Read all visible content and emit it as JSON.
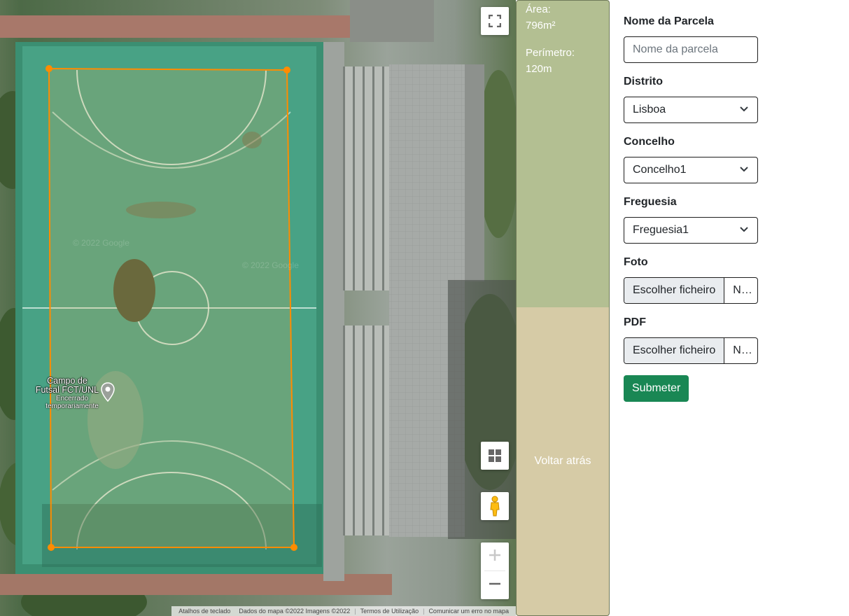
{
  "map": {
    "poi_name": "Campo de Futsal FCT/UNL",
    "poi_name_line1": "Campo de",
    "poi_name_line2": "Futsal FCT/UNL",
    "poi_status": "Encerrado temporariamente",
    "poi_status_line1": "Encerrado",
    "poi_status_line2": "temporariamente",
    "watermark": "© 2022 Google",
    "attribution": {
      "keyboard_shortcuts": "Atalhos de teclado",
      "map_data": "Dados do mapa ©2022 Imagens ©2022",
      "terms": "Termos de Utilização",
      "report_error": "Comunicar um erro no mapa"
    },
    "controls": {
      "fullscreen_icon": "fullscreen-icon",
      "map_type_icon": "grid-icon",
      "pegman_icon": "pegman-icon",
      "zoom_in_icon": "plus-icon",
      "zoom_out_icon": "minus-icon"
    },
    "polygon_color": "#ff8c00"
  },
  "info": {
    "area_label": "Área:",
    "area_value": "796m²",
    "perimeter_label": "Perímetro:",
    "perimeter_value": "120m",
    "back_label": "Voltar atrás"
  },
  "form": {
    "name_label": "Nome da Parcela",
    "name_placeholder": "Nome da parcela",
    "district_label": "Distrito",
    "district_value": "Lisboa",
    "municipality_label": "Concelho",
    "municipality_value": "Concelho1",
    "parish_label": "Freguesia",
    "parish_value": "Freguesia1",
    "photo_label": "Foto",
    "photo_choose": "Escolher ficheiro",
    "photo_file": "Nenhum ficheiro selecionado",
    "pdf_label": "PDF",
    "pdf_choose": "Escolher ficheiro",
    "pdf_file": "Nenhum ficheiro selecionado",
    "submit_label": "Submeter"
  },
  "colors": {
    "info_panel": "#b3bf92",
    "back_panel": "#d6cba6",
    "submit": "#198754",
    "court": "#3f9c80",
    "polygon": "#ff8c00"
  }
}
